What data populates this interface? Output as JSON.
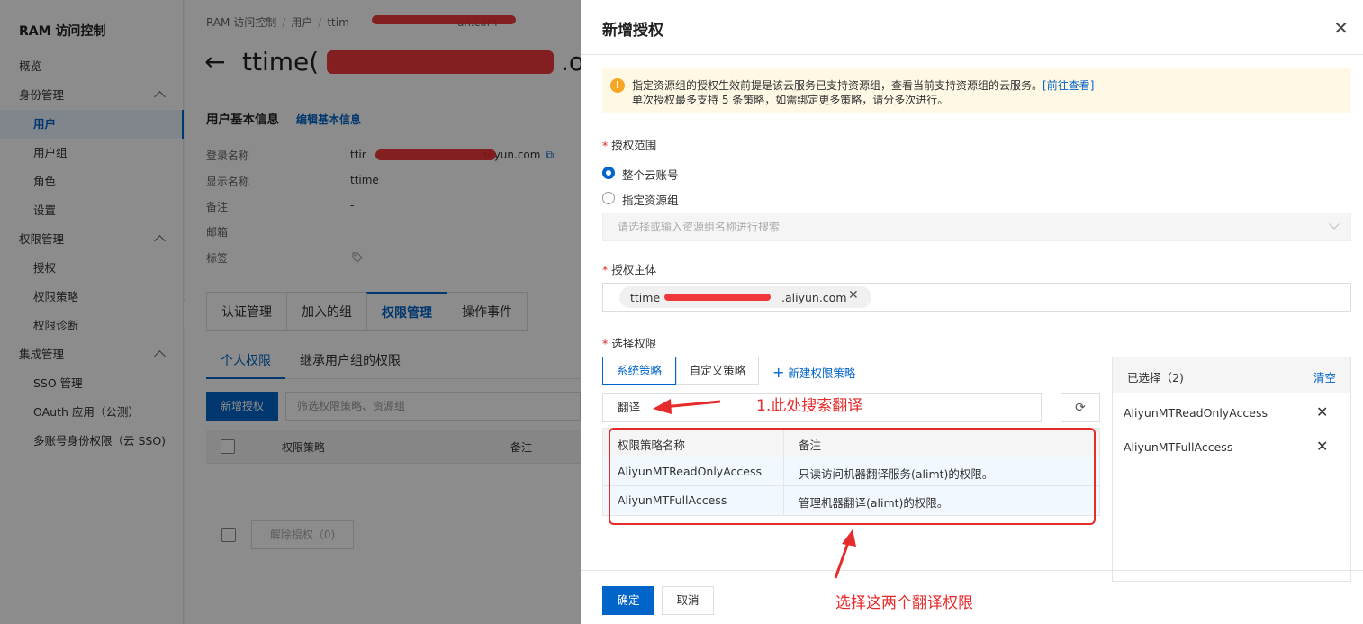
{
  "sidebar": {
    "brand": "RAM 访问控制",
    "items": [
      {
        "label": "概览"
      },
      {
        "label": "身份管理"
      },
      {
        "label": "用户"
      },
      {
        "label": "用户组"
      },
      {
        "label": "角色"
      },
      {
        "label": "设置"
      },
      {
        "label": "权限管理"
      },
      {
        "label": "授权"
      },
      {
        "label": "权限策略"
      },
      {
        "label": "权限诊断"
      },
      {
        "label": "集成管理"
      },
      {
        "label": "SSO 管理"
      },
      {
        "label": "OAuth 应用（公测）"
      },
      {
        "label": "多账号身份权限（云 SSO)"
      }
    ],
    "collapse_glyph": "‹"
  },
  "main": {
    "breadcrumb": [
      "RAM 访问控制",
      "用户",
      "ttim"
    ],
    "breadcrumb_tail": "un.com",
    "breadcrumb_sep": "/",
    "back_glyph": "←",
    "title_prefix": "ttime(",
    "title_suffix": ".o",
    "section_title": "用户基本信息",
    "edit_link": "编辑基本信息",
    "info": [
      {
        "label": "登录名称",
        "value_prefix": "ttir",
        "value_suffix": "aliyun.com"
      },
      {
        "label": "显示名称",
        "value": "ttime"
      },
      {
        "label": "备注",
        "value": "-"
      },
      {
        "label": "邮箱",
        "value": "-"
      },
      {
        "label": "标签"
      }
    ],
    "tabs": [
      "认证管理",
      "加入的组",
      "权限管理",
      "操作事件"
    ],
    "subtabs": [
      "个人权限",
      "继承用户组的权限"
    ],
    "add_auth_btn": "新增授权",
    "filter_placeholder": "筛选权限策略、资源组",
    "table_headers": [
      "权限策略",
      "备注"
    ],
    "unauth_btn": "解除授权（0)"
  },
  "drawer": {
    "title": "新增授权",
    "close_glyph": "✕",
    "notice_icon": "!",
    "notice_line1": "指定资源组的授权生效前提是该云服务已支持资源组，查看当前支持资源组的云服务。",
    "notice_link": "[前往查看]",
    "notice_line2": "单次授权最多支持 5 条策略，如需绑定更多策略，请分多次进行。",
    "required_mark": "*",
    "scope_label": "授权范围",
    "scope_options": [
      "整个云账号",
      "指定资源组"
    ],
    "resource_group_placeholder": "请选择或输入资源组名称进行搜索",
    "principal_label": "授权主体",
    "principal_chip_prefix": "ttime",
    "principal_chip_suffix": ".aliyun.com",
    "chip_close_glyph": "✕",
    "permission_label": "选择权限",
    "policy_tabs": [
      "系统策略",
      "自定义策略"
    ],
    "new_policy_plus": "+",
    "new_policy": "新建权限策略",
    "search_value": "翻译",
    "refresh_glyph": "⟳",
    "policy_table": {
      "headers": [
        "权限策略名称",
        "备注"
      ],
      "rows": [
        {
          "name": "AliyunMTReadOnlyAccess",
          "note": "只读访问机器翻译服务(alimt)的权限。"
        },
        {
          "name": "AliyunMTFullAccess",
          "note": "管理机器翻译(alimt)的权限。"
        }
      ]
    },
    "selected_title": "已选择（2)",
    "clear": "清空",
    "selected_items": [
      "AliyunMTReadOnlyAccess",
      "AliyunMTFullAccess"
    ],
    "remove_glyph": "✕",
    "ok_btn": "确定",
    "cancel_btn": "取消"
  },
  "annotations": {
    "search_note": "1.此处搜索翻译",
    "select_note": "选择这两个翻译权限",
    "color": "#e52b2b"
  },
  "colors": {
    "primary": "#0064c8",
    "warning_bg": "#fff8e5",
    "warning_icon": "#f5a623"
  }
}
